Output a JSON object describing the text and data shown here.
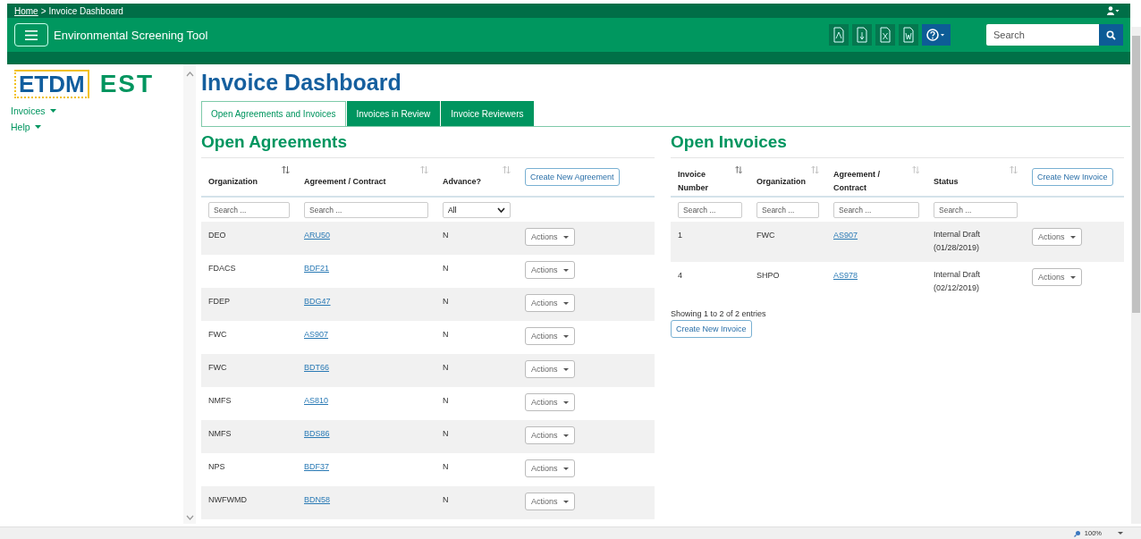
{
  "breadcrumb": {
    "home": "Home",
    "separator": ">",
    "current": "Invoice Dashboard"
  },
  "app_title": "Environmental Screening Tool",
  "search": {
    "placeholder": "Search"
  },
  "logos": {
    "primary": "ETDM",
    "secondary": "EST"
  },
  "sidebar": {
    "items": [
      {
        "label": "Invoices"
      },
      {
        "label": "Help"
      }
    ]
  },
  "page_title": "Invoice Dashboard",
  "tabs": [
    {
      "label": "Open Agreements and Invoices",
      "selected": true
    },
    {
      "label": "Invoices in Review",
      "selected": false
    },
    {
      "label": "Invoice Reviewers",
      "selected": false
    }
  ],
  "agreements": {
    "title": "Open Agreements",
    "create_button": "Create New Agreement",
    "columns": [
      {
        "label": "Organization",
        "sorted": true
      },
      {
        "label": "Agreement / Contract",
        "sorted": false
      },
      {
        "label": "Advance?",
        "sorted": false
      }
    ],
    "filters": [
      {
        "placeholder": "Search ..."
      },
      {
        "placeholder": "Search ..."
      }
    ],
    "advance_filter": "All",
    "rows": [
      {
        "organization": "DEO",
        "agreement": "ARU50",
        "advance": "N",
        "action": "Actions"
      },
      {
        "organization": "FDACS",
        "agreement": "BDF21",
        "advance": "N",
        "action": "Actions"
      },
      {
        "organization": "FDEP",
        "agreement": "BDG47",
        "advance": "N",
        "action": "Actions"
      },
      {
        "organization": "FWC",
        "agreement": "AS907",
        "advance": "N",
        "action": "Actions"
      },
      {
        "organization": "FWC",
        "agreement": "BDT66",
        "advance": "N",
        "action": "Actions"
      },
      {
        "organization": "NMFS",
        "agreement": "AS810",
        "advance": "N",
        "action": "Actions"
      },
      {
        "organization": "NMFS",
        "agreement": "BDS86",
        "advance": "N",
        "action": "Actions"
      },
      {
        "organization": "NPS",
        "agreement": "BDF37",
        "advance": "N",
        "action": "Actions"
      },
      {
        "organization": "NWFWMD",
        "agreement": "BDN58",
        "advance": "N",
        "action": "Actions"
      }
    ]
  },
  "invoices": {
    "title": "Open Invoices",
    "create_button": "Create New Invoice",
    "columns": [
      {
        "label": "Invoice Number",
        "sorted": true
      },
      {
        "label": "Organization",
        "sorted": false
      },
      {
        "label": "Agreement / Contract",
        "sorted": false
      },
      {
        "label": "Status",
        "sorted": false
      }
    ],
    "filters": [
      {
        "placeholder": "Search ..."
      },
      {
        "placeholder": "Search ..."
      },
      {
        "placeholder": "Search ..."
      },
      {
        "placeholder": "Search ..."
      }
    ],
    "rows": [
      {
        "number": "1",
        "organization": "FWC",
        "agreement": "AS907",
        "status": "Internal Draft (01/28/2019)",
        "action": "Actions"
      },
      {
        "number": "4",
        "organization": "SHPO",
        "agreement": "AS978",
        "status": "Internal Draft (02/12/2019)",
        "action": "Actions"
      }
    ],
    "footer": "Showing 1 to 2 of 2 entries",
    "footer_button": "Create New Invoice"
  },
  "status_bar": {
    "zoom": "100%"
  }
}
